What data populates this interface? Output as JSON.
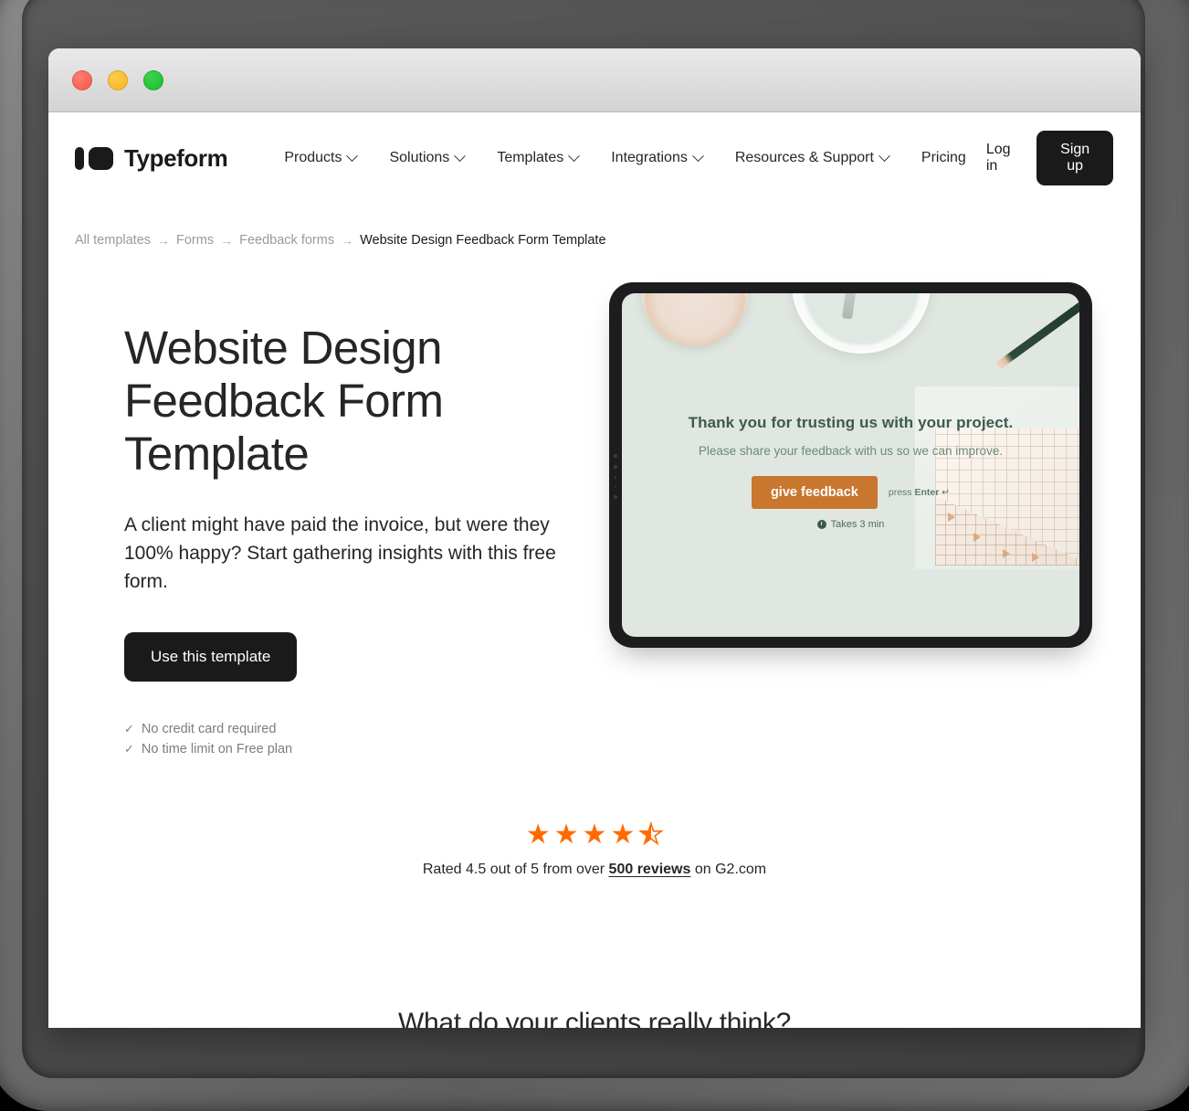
{
  "window": {
    "traffic_lights": [
      "close",
      "minimize",
      "maximize"
    ]
  },
  "nav": {
    "brand": "Typeform",
    "links": [
      {
        "label": "Products",
        "has_dropdown": true
      },
      {
        "label": "Solutions",
        "has_dropdown": true
      },
      {
        "label": "Templates",
        "has_dropdown": true
      },
      {
        "label": "Integrations",
        "has_dropdown": true
      },
      {
        "label": "Resources & Support",
        "has_dropdown": true
      },
      {
        "label": "Pricing",
        "has_dropdown": false
      }
    ],
    "login_label": "Log in",
    "signup_label": "Sign up"
  },
  "breadcrumb": {
    "items": [
      "All templates",
      "Forms",
      "Feedback forms"
    ],
    "separator": "→",
    "current": "Website Design Feedback Form Template"
  },
  "hero": {
    "title": "Website Design Feedback Form Template",
    "description": "A client might have paid the invoice, but were they 100% happy? Start gathering insights with this free form.",
    "cta_label": "Use this template",
    "perks": [
      {
        "check": "✓",
        "label": "No credit card required"
      },
      {
        "check": "✓",
        "label": "No time limit on Free plan"
      }
    ]
  },
  "preview": {
    "form_title": "Thank you for trusting us with your project.",
    "form_subtitle": "Please share your feedback with us so we can improve.",
    "cta_label": "give feedback",
    "press_enter_prefix": "press ",
    "press_enter_key": "Enter",
    "press_enter_symbol": " ↵",
    "takes_label": "Takes 3 min",
    "accent_color": "#c9762e",
    "background_color": "#dfe7e0",
    "text_color": "#3d5a4d"
  },
  "rating": {
    "value": 4.5,
    "max": 5,
    "full_stars": 4,
    "half_star": true,
    "star_glyph": "★",
    "star_color": "#ff6a00",
    "text_prefix": "Rated 4.5 out of 5 from over ",
    "link_text": "500 reviews",
    "text_suffix": " on G2.com"
  },
  "section": {
    "heading": "What do your clients really think?"
  }
}
